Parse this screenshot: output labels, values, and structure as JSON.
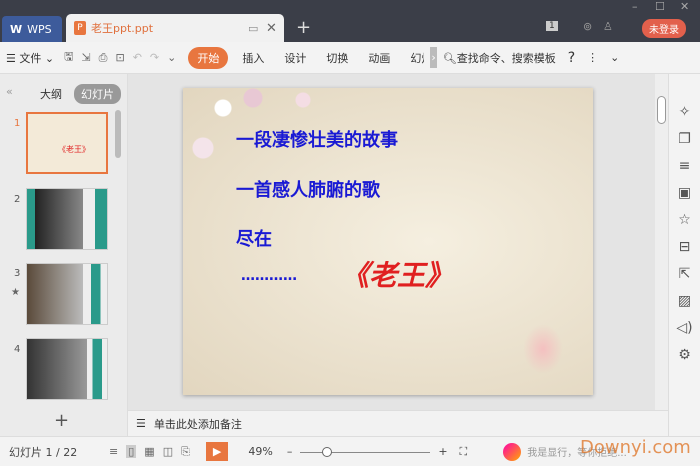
{
  "titlebar": {
    "app_tab": "WPS",
    "doc_tab": "老王ppt.ppt",
    "new_tab": "+",
    "login": "未登录",
    "badge": "1"
  },
  "toolbar": {
    "file": "文件",
    "tabs": [
      "开始",
      "插入",
      "设计",
      "切换",
      "动画",
      "幻灯"
    ],
    "search": "查找命令、搜索模板",
    "help": "?"
  },
  "leftpanel": {
    "outline": "大纲",
    "slides": "幻灯片",
    "add": "+",
    "thumbs": [
      "1",
      "2",
      "3",
      "4"
    ]
  },
  "slide": {
    "line1": "一段凄惨壮美的故事",
    "line2": "一首感人肺腑的歌",
    "line3": "尽在",
    "dots": "…………",
    "title": "《老王》"
  },
  "notes": {
    "placeholder": "单击此处添加备注"
  },
  "status": {
    "slide_counter": "幻灯片 1 / 22",
    "zoom": "49%",
    "assistant": "我是显行，等你拒绝...",
    "watermark": "Downyi.com"
  },
  "colors": {
    "accent": "#e8763f",
    "slide_text": "#1a1ad4",
    "title_red": "#e02020"
  }
}
